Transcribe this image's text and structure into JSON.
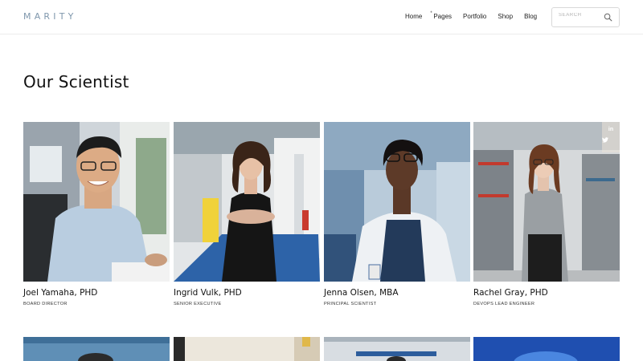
{
  "header": {
    "logo": "MARITY",
    "nav": [
      {
        "label": "Home"
      },
      {
        "label": "Pages",
        "marker": "*"
      },
      {
        "label": "Portfolio"
      },
      {
        "label": "Shop"
      },
      {
        "label": "Blog"
      }
    ],
    "search": {
      "placeholder": "SEARCH"
    }
  },
  "page": {
    "title": "Our Scientist"
  },
  "team": [
    {
      "name": "Joel Yamaha, PHD",
      "role": "BOARD DIRECTOR"
    },
    {
      "name": "Ingrid Vulk, PHD",
      "role": "SENIOR EXECUTIVE"
    },
    {
      "name": "Jenna Olsen, MBA",
      "role": "PRINCIPAL SCIENTIST"
    },
    {
      "name": "Rachel Gray, PHD",
      "role": "DEVOPS LEAD ENGINEER",
      "social": {
        "linkedin": "in",
        "twitter": "t"
      }
    }
  ]
}
